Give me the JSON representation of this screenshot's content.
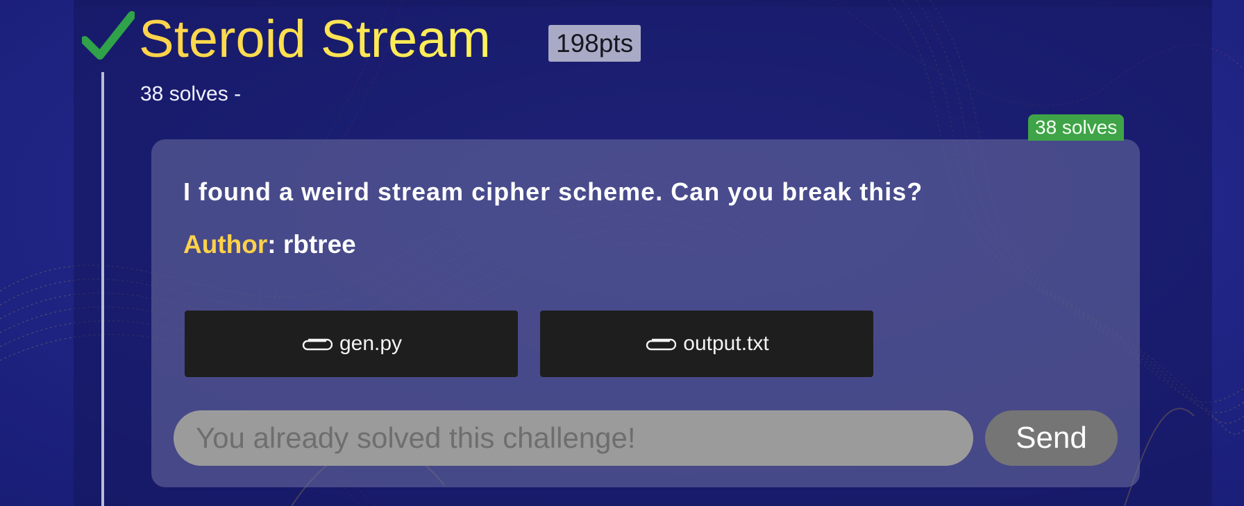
{
  "challenge": {
    "title": "Steroid Stream",
    "points": "198pts",
    "solves_summary": "38 solves -",
    "solves_tag": "38 solves",
    "status_icon": "check-icon",
    "description": "I found a weird stream cipher scheme. Can you break this?",
    "author_label": "Author",
    "author_separator": ": ",
    "author": "rbtree"
  },
  "files": [
    {
      "name": "gen.py",
      "icon": "paperclip-icon"
    },
    {
      "name": "output.txt",
      "icon": "paperclip-icon"
    }
  ],
  "flag_form": {
    "placeholder": "You already solved this challenge!",
    "submit_label": "Send"
  },
  "colors": {
    "background": "#1a2080",
    "title_gradient_start": "#ffd24a",
    "title_gradient_end": "#fff35a",
    "check": "#2fa24a",
    "solves_tag": "#3fa447",
    "author_label": "#ffd24a",
    "file_button": "#1e1e1e",
    "input": "#9b9b9b",
    "send_button": "#757575"
  }
}
